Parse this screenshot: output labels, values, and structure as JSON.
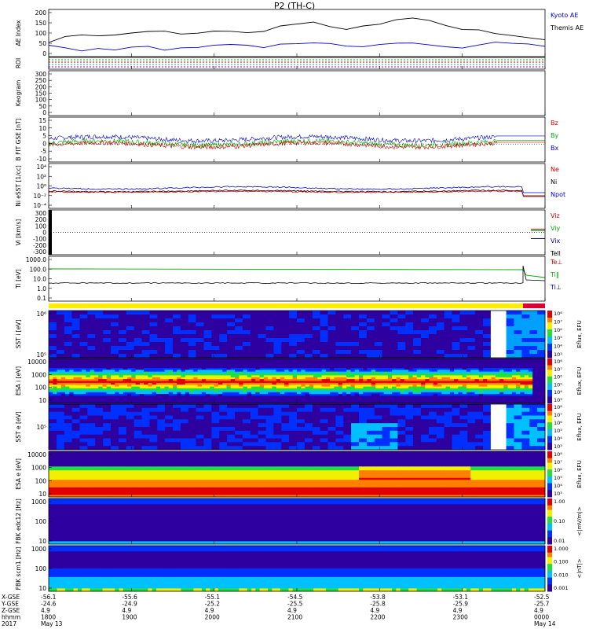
{
  "title": "P2 (TH-C)",
  "chart_data": {
    "type": "line",
    "panels": [
      {
        "id": "ae",
        "ylabel": "AE Index",
        "yticks": [
          "200",
          "150",
          "100",
          "50",
          "0"
        ],
        "ylim": [
          0,
          200
        ],
        "legend": [
          {
            "name": "Kyoto AE",
            "color": "#0000cc"
          },
          {
            "name": "Themis AE",
            "color": "#000000"
          }
        ],
        "series": [
          {
            "name": "Themis AE",
            "color": "#000000",
            "values": [
              60,
              85,
              95,
              90,
              92,
              100,
              110,
              105,
              95,
              100,
              110,
              105,
              100,
              110,
              130,
              140,
              145,
              130,
              115,
              130,
              140,
              160,
              160,
              150,
              135,
              115,
              110,
              100,
              90,
              80,
              70
            ]
          },
          {
            "name": "Kyoto AE",
            "color": "#0000cc",
            "values": [
              50,
              40,
              20,
              35,
              30,
              40,
              45,
              30,
              35,
              40,
              50,
              55,
              45,
              40,
              50,
              55,
              60,
              55,
              45,
              40,
              50,
              60,
              60,
              50,
              45,
              40,
              50,
              60,
              55,
              50,
              45
            ]
          }
        ]
      },
      {
        "id": "roi",
        "ylabel": "ROI",
        "yticks": []
      },
      {
        "id": "keogram",
        "ylabel": "Keogram",
        "yticks": [
          "300",
          "250",
          "200",
          "150",
          "100",
          "50",
          "0"
        ]
      },
      {
        "id": "bfield",
        "ylabel": "B FIT GSE [nT]",
        "yticks": [
          "15",
          "10",
          "5",
          "0",
          "-5",
          "-10"
        ],
        "ylim": [
          -10,
          15
        ],
        "legend": [
          {
            "name": "Bz",
            "color": "#cc0000"
          },
          {
            "name": "By",
            "color": "#00aa00"
          },
          {
            "name": "Bx",
            "color": "#0000cc"
          }
        ]
      },
      {
        "id": "density",
        "ylabel": "Ni eSST [1/cc]",
        "yticks": [
          "10⁴",
          "10²",
          "10⁰",
          "10⁻²",
          "10⁻⁴"
        ],
        "legend": [
          {
            "name": "Ne",
            "color": "#cc0000"
          },
          {
            "name": "Ni",
            "color": "#000000"
          },
          {
            "name": "Npot",
            "color": "#0000cc"
          }
        ]
      },
      {
        "id": "velocity",
        "ylabel": "Vi [km/s]",
        "yticks": [
          "300",
          "200",
          "100",
          "0",
          "-100",
          "-200",
          "-300"
        ],
        "legend": [
          {
            "name": "Viz",
            "color": "#cc0000"
          },
          {
            "name": "Viy",
            "color": "#00aa00"
          },
          {
            "name": "Vix",
            "color": "#0000cc"
          },
          {
            "name": "Tell",
            "color": "#000000"
          }
        ]
      },
      {
        "id": "temperature",
        "ylabel": "Ti [eV]",
        "yticks": [
          "1000.0",
          "100.0",
          "10.0",
          "1.0",
          "0.1"
        ],
        "legend": [
          {
            "name": "Te⊥",
            "color": "#cc0000"
          },
          {
            "name": "Ti‖",
            "color": "#00aa00"
          },
          {
            "name": "Ti⊥",
            "color": "#0000cc"
          }
        ]
      },
      {
        "id": "sst_i",
        "ylabel": "SST i [eV]",
        "yticks": [
          "10⁶",
          "10⁵"
        ],
        "cbar": "Eflux, EFU"
      },
      {
        "id": "esa_i",
        "ylabel": "ESA i [eV]",
        "yticks": [
          "10000",
          "1000",
          "100",
          "10"
        ],
        "cbar": "Eflux, EFU"
      },
      {
        "id": "sst_e",
        "ylabel": "SST e [eV]",
        "yticks": [
          "10⁵"
        ],
        "cbar": "Eflux, EFU"
      },
      {
        "id": "esa_e",
        "ylabel": "ESA e [eV]",
        "yticks": [
          "10000",
          "1000",
          "100",
          "10"
        ],
        "cbar": "Eflux, EFU"
      },
      {
        "id": "fbk_e",
        "ylabel": "FBK edc12 [Hz]",
        "yticks": [
          "1000",
          "100",
          "10"
        ],
        "cbar": "<|mV/m|>",
        "cticks": [
          "1.00",
          "0.10",
          "0.01"
        ]
      },
      {
        "id": "fbk_b",
        "ylabel": "FBK scm1 [Hz]",
        "yticks": [
          "1000",
          "100",
          "10"
        ],
        "cbar": "<|nT|>",
        "cticks": [
          "1.000",
          "0.100",
          "0.010",
          "0.001"
        ]
      }
    ],
    "cbar_eflux_ticks": [
      "10⁸",
      "10⁷",
      "10⁶",
      "10⁵",
      "10⁴",
      "10³"
    ]
  },
  "xaxis": {
    "row_labels": [
      "X-GSE",
      "Y-GSE",
      "Z-GSE",
      "hhmm",
      "2017"
    ],
    "ticks": [
      {
        "x": "-56.1",
        "y": "-24.6",
        "z": "4.9",
        "t": "1800",
        "d": "May 13"
      },
      {
        "x": "-55.6",
        "y": "-24.9",
        "z": "4.9",
        "t": "1900",
        "d": ""
      },
      {
        "x": "-55.1",
        "y": "-25.2",
        "z": "4.9",
        "t": "2000",
        "d": ""
      },
      {
        "x": "-54.5",
        "y": "-25.5",
        "z": "4.9",
        "t": "2100",
        "d": ""
      },
      {
        "x": "-53.8",
        "y": "-25.8",
        "z": "4.9",
        "t": "2200",
        "d": ""
      },
      {
        "x": "-53.1",
        "y": "-25.9",
        "z": "4.9",
        "t": "2300",
        "d": ""
      },
      {
        "x": "-52.5",
        "y": "-25.7",
        "z": "4.9",
        "t": "0000",
        "d": "May 14"
      }
    ]
  }
}
